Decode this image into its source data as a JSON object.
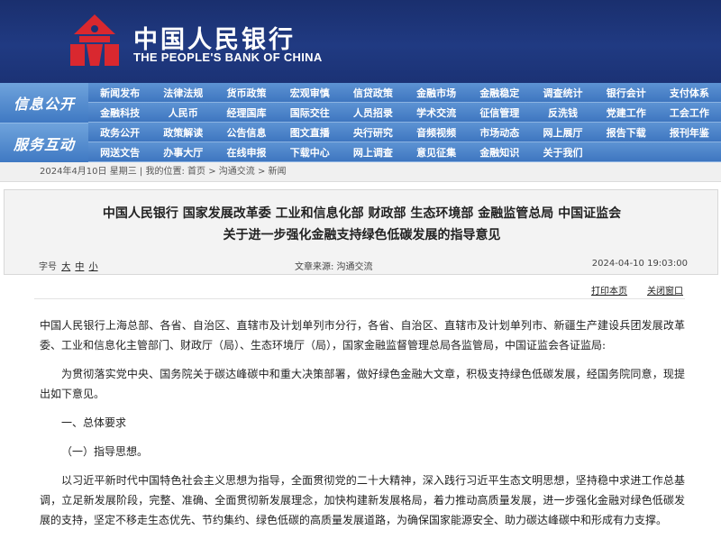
{
  "banner": {
    "name_cn": "中国人民银行",
    "name_en": "THE PEOPLE'S BANK OF CHINA",
    "logo_color": "#d9282f"
  },
  "nav": {
    "groups": [
      {
        "label": "信息公开"
      },
      {
        "label": "服务互动"
      }
    ],
    "rows": [
      [
        "新闻发布",
        "法律法规",
        "货币政策",
        "宏观审慎",
        "信贷政策",
        "金融市场",
        "金融稳定",
        "调查统计",
        "银行会计",
        "支付体系"
      ],
      [
        "金融科技",
        "人民币",
        "经理国库",
        "国际交往",
        "人员招录",
        "学术交流",
        "征信管理",
        "反洗钱",
        "党建工作",
        "工会工作"
      ],
      [
        "政务公开",
        "政策解读",
        "公告信息",
        "图文直播",
        "央行研究",
        "音频视频",
        "市场动态",
        "网上展厅",
        "报告下载",
        "报刊年鉴"
      ],
      [
        "网送文告",
        "办事大厅",
        "在线申报",
        "下载中心",
        "网上调查",
        "意见征集",
        "金融知识",
        "关于我们",
        "",
        ""
      ]
    ]
  },
  "breadcrumb": {
    "date": "2024年4月10日 星期三",
    "location_label": "我的位置:",
    "items": [
      "首页",
      "沟通交流",
      "新闻"
    ]
  },
  "article": {
    "title_line1": "中国人民银行 国家发展改革委 工业和信息化部 财政部 生态环境部 金融监管总局 中国证监会",
    "title_line2": "关于进一步强化金融支持绿色低碳发展的指导意见",
    "font_size_label": "字号",
    "font_sizes": [
      "大",
      "中",
      "小"
    ],
    "source": "文章来源:  沟通交流",
    "date": "2024-04-10 19:03:00",
    "print_label": "打印本页",
    "close_label": "关闭窗口",
    "paragraphs": [
      {
        "type": "plain",
        "text": "中国人民银行上海总部、各省、自治区、直辖市及计划单列市分行，各省、自治区、直辖市及计划单列市、新疆生产建设兵团发展改革委、工业和信息化主管部门、财政厅（局）、生态环境厅（局），国家金融监督管理总局各监管局，中国证监会各证监局:"
      },
      {
        "type": "indent",
        "text": "为贯彻落实党中央、国务院关于碳达峰碳中和重大决策部署，做好绿色金融大文章，积极支持绿色低碳发展，经国务院同意，现提出如下意见。"
      },
      {
        "type": "heading",
        "text": "一、总体要求"
      },
      {
        "type": "heading",
        "text": "（一）指导思想。"
      },
      {
        "type": "indent",
        "text": "以习近平新时代中国特色社会主义思想为指导，全面贯彻党的二十大精神，深入践行习近平生态文明思想，坚持稳中求进工作总基调，立足新发展阶段，完整、准确、全面贯彻新发展理念，加快构建新发展格局，着力推动高质量发展，进一步强化金融对绿色低碳发展的支持，坚定不移走生态优先、节约集约、绿色低碳的高质量发展道路，为确保国家能源安全、助力碳达峰碳中和形成有力支撑。"
      }
    ]
  }
}
